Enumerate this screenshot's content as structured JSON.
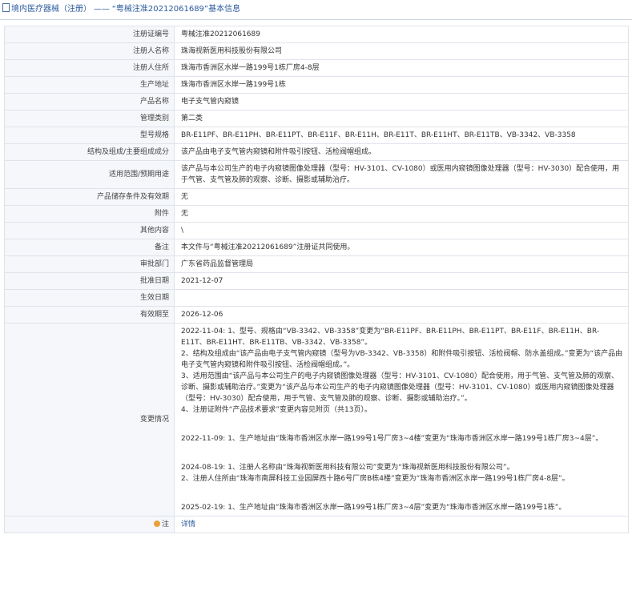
{
  "header": {
    "prefix": "境内医疗器械（注册）",
    "separator": "——",
    "title": "“粤械注准20212061689”基本信息"
  },
  "rows": {
    "reg_no": {
      "label": "注册证编号",
      "value": "粤械注准20212061689"
    },
    "registrant": {
      "label": "注册人名称",
      "value": "珠海视新医用科技股份有限公司"
    },
    "registrant_addr": {
      "label": "注册人住所",
      "value": "珠海市香洲区水岸一路199号1栋厂房4-8层"
    },
    "prod_addr": {
      "label": "生产地址",
      "value": "珠海市香洲区水岸一路199号1栋"
    },
    "product_name": {
      "label": "产品名称",
      "value": "电子支气管内窥镜"
    },
    "mgmt_class": {
      "label": "管理类别",
      "value": "第二类"
    },
    "model": {
      "label": "型号规格",
      "value": "BR-E11PF、BR-E11PH、BR-E11PT、BR-E11F、BR-E11H、BR-E11T、BR-E11HT、BR-E11TB、VB-3342、VB-3358"
    },
    "structure": {
      "label": "结构及组成/主要组成成分",
      "value": "该产品由电子支气管内窥镜和附件吸引按钮、活检阀帽组成。"
    },
    "scope": {
      "label": "适用范围/预期用途",
      "value": "该产品与本公司生产的电子内窥镜图像处理器（型号：HV-3101、CV-1080）或医用内窥镜图像处理器（型号：HV-3030）配合使用，用于气管、支气管及肺的观察、诊断、摄影或辅助治疗。"
    },
    "storage": {
      "label": "产品储存条件及有效期",
      "value": "无"
    },
    "attachment": {
      "label": "附件",
      "value": "无"
    },
    "other": {
      "label": "其他内容",
      "value": "\\"
    },
    "remark": {
      "label": "备注",
      "value": "本文件与“粤械注准20212061689”注册证共同使用。"
    },
    "approver": {
      "label": "审批部门",
      "value": "广东省药品监督管理局"
    },
    "approve_date": {
      "label": "批准日期",
      "value": "2021-12-07"
    },
    "effective_date": {
      "label": "生效日期",
      "value": ""
    },
    "expiry": {
      "label": "有效期至",
      "value": "2026-12-06"
    },
    "changes_label": "变更情况",
    "note": {
      "label": "注",
      "link": "详情"
    }
  },
  "changes": [
    "2022-11-04: 1、型号、规格由“VB-3342、VB-3358”变更为“BR-E11PF、BR-E11PH、BR-E11PT、BR-E11F、BR-E11H、BR-E11T、BR-E11HT、BR-E11TB、VB-3342、VB-3358”。",
    "2、结构及组成由“该产品由电子支气管内窥镜（型号为VB-3342、VB-3358）和附件吸引按钮、活检阀帽、防水盖组成。”变更为“该产品由电子支气管内窥镜和附件吸引按钮、活检阀帽组成。”。",
    "3、适用范围由“该产品与本公司生产的电子内窥镜图像处理器（型号：HV-3101、CV-1080）配合使用，用于气管、支气管及肺的观察、诊断、摄影或辅助治疗。”变更为“该产品与本公司生产的电子内窥镜图像处理器（型号：HV-3101、CV-1080）或医用内窥镜图像处理器（型号：HV-3030）配合使用，用于气管、支气管及肺的观察、诊断、摄影或辅助治疗。”。",
    "4、注册证附件“产品技术要求”变更内容见附页（共13页）。",
    "2022-11-09: 1、生产地址由“珠海市香洲区水岸一路199号1号厂房3~4楼”变更为“珠海市香洲区水岸一路199号1栋厂房3~4层”。",
    "2024-08-19: 1、注册人名称由“珠海视新医用科技有限公司”变更为“珠海视新医用科技股份有限公司”。",
    "2、注册人住所由“珠海市南屏科技工业园屏西十路6号厂房B栋4楼”变更为“珠海市香洲区水岸一路199号1栋厂房4-8层”。",
    "2025-02-19: 1、生产地址由“珠海市香洲区水岸一路199号1栋厂房3~4层”变更为“珠海市香洲区水岸一路199号1栋”。"
  ]
}
